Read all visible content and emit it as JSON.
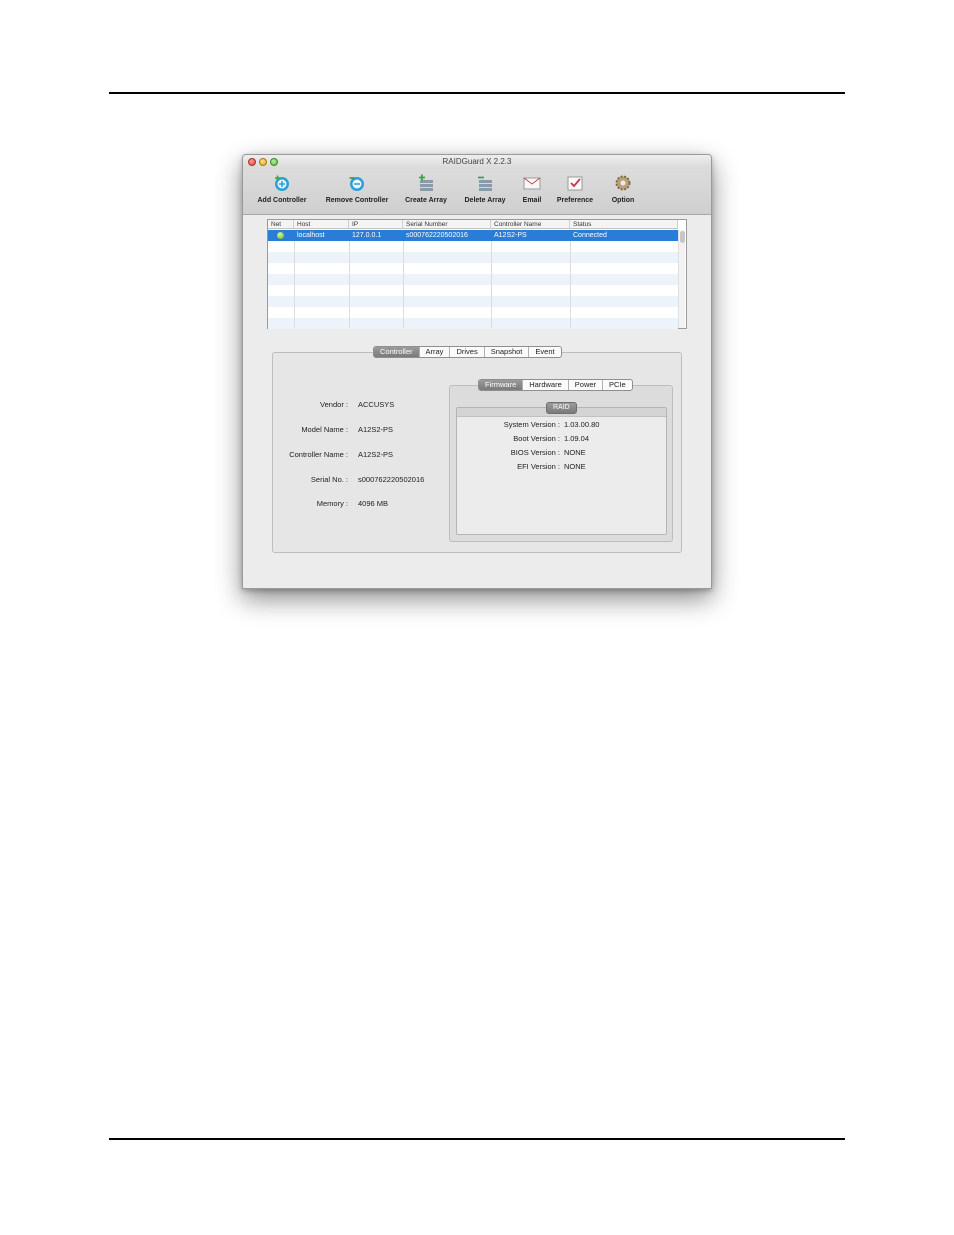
{
  "window": {
    "title": "RAIDGuard X 2.2.3"
  },
  "toolbar": {
    "add_controller": "Add Controller",
    "remove_controller": "Remove Controller",
    "create_array": "Create Array",
    "delete_array": "Delete Array",
    "email": "Email",
    "preference": "Preference",
    "option": "Option"
  },
  "controller_table": {
    "headers": [
      "Net",
      "Host",
      "IP",
      "Serial Number",
      "Controller Name",
      "Status"
    ],
    "rows": [
      {
        "net": "online",
        "host": "localhost",
        "ip": "127.0.0.1",
        "serial": "s000762220502016",
        "name": "A12S2-PS",
        "status": "Connected"
      }
    ]
  },
  "main_tabs": {
    "items": [
      "Controller",
      "Array",
      "Drives",
      "Snapshot",
      "Event"
    ],
    "selected": "Controller"
  },
  "controller_info": {
    "vendor_label": "Vendor :",
    "vendor": "ACCUSYS",
    "model_label": "Model Name :",
    "model": "A12S2-PS",
    "controller_label": "Controller Name :",
    "controller": "A12S2-PS",
    "serial_label": "Serial No. :",
    "serial": "s000762220502016",
    "memory_label": "Memory :",
    "memory": "4096 MB"
  },
  "sub_tabs": {
    "items": [
      "Firmware",
      "Hardware",
      "Power",
      "PCIe"
    ],
    "selected": "Firmware"
  },
  "raid": {
    "title": "RAID",
    "system_label": "System Version :",
    "system": "1.03.00.80",
    "boot_label": "Boot Version :",
    "boot": "1.09.04",
    "bios_label": "BIOS Version :",
    "bios": "NONE",
    "efi_label": "EFI Version :",
    "efi": "NONE"
  },
  "colors": {
    "selection": "#2a7dd6",
    "row_alt": "#edf3fb",
    "status_online": "#64b414"
  }
}
